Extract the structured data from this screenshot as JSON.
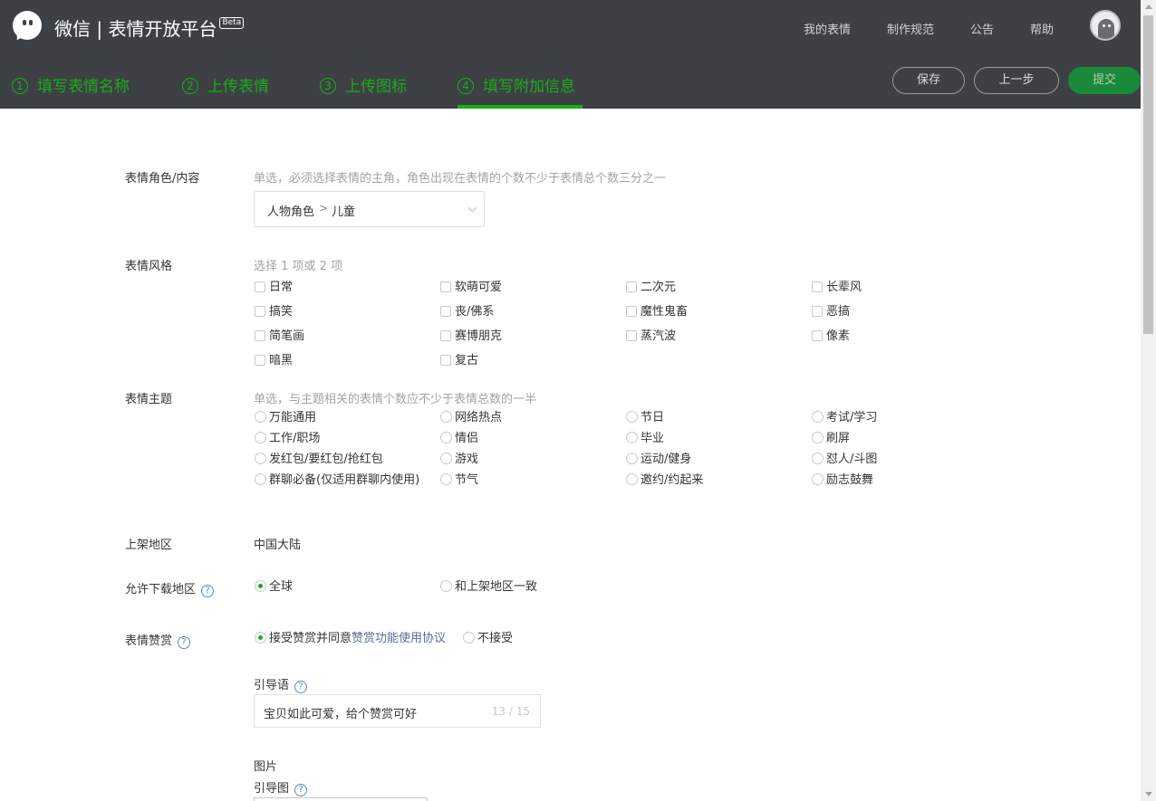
{
  "header": {
    "brand": "微信 | 表情开放平台",
    "beta": "Beta",
    "nav": [
      "我的表情",
      "制作规范",
      "公告",
      "帮助"
    ],
    "steps": [
      {
        "num": "1",
        "label": "填写表情名称"
      },
      {
        "num": "2",
        "label": "上传表情"
      },
      {
        "num": "3",
        "label": "上传图标"
      },
      {
        "num": "4",
        "label": "填写附加信息"
      }
    ],
    "active_step": 4,
    "buttons": {
      "save": "保存",
      "prev": "上一步",
      "submit": "提交"
    }
  },
  "form": {
    "role": {
      "label": "表情角色/内容",
      "hint": "单选，必须选择表情的主角，角色出现在表情的个数不少于表情总个数三分之一",
      "selected_category": "人物角色",
      "selected_value": "儿童"
    },
    "style": {
      "label": "表情风格",
      "hint": "选择 1 项或 2 项",
      "options": [
        "日常",
        "软萌可爱",
        "二次元",
        "长辈风",
        "搞笑",
        "丧/佛系",
        "魔性鬼畜",
        "恶搞",
        "简笔画",
        "赛博朋克",
        "蒸汽波",
        "像素",
        "暗黑",
        "复古"
      ]
    },
    "theme": {
      "label": "表情主题",
      "hint": "单选，与主题相关的表情个数应不少于表情总数的一半",
      "options": [
        "万能通用",
        "网络热点",
        "节日",
        "考试/学习",
        "工作/职场",
        "情侣",
        "毕业",
        "刷屏",
        "发红包/要红包/抢红包",
        "游戏",
        "运动/健身",
        "怼人/斗图",
        "群聊必备(仅适用群聊内使用)",
        "节气",
        "邀约/约起来",
        "励志鼓舞"
      ]
    },
    "region": {
      "label": "上架地区",
      "value": "中国大陆"
    },
    "download": {
      "label": "允许下载地区",
      "options": [
        "全球",
        "和上架地区一致"
      ],
      "selected": "全球"
    },
    "reward": {
      "label": "表情赞赏",
      "accept_prefix": "接受赞赏并同意",
      "accept_link": "赞赏功能使用协议",
      "decline": "不接受",
      "selected": "accept",
      "guide_label": "引导语",
      "guide_value": "宝贝如此可爱，给个赞赏可好",
      "guide_count": "13 / 15",
      "image_label": "图片",
      "guide_image_label": "引导图"
    }
  },
  "colors": {
    "accent": "#1aad19",
    "header_bg": "#3d4144",
    "link": "#576b95"
  }
}
